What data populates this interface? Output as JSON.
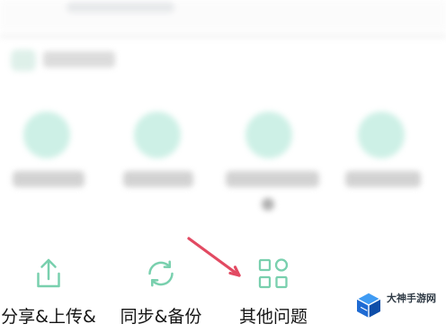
{
  "bottom_actions": [
    {
      "label": "分享&上传&",
      "icon": "share-upload-icon"
    },
    {
      "label": "同步&备份",
      "icon": "sync-icon"
    },
    {
      "label": "其他问题",
      "icon": "grid-add-icon"
    }
  ],
  "watermark": {
    "text": "大神手游网",
    "logo": "box-logo"
  },
  "colors": {
    "accent": "#79d0ae",
    "blur_card": "#c9efe4",
    "arrow": "#e24a62",
    "text": "#151515"
  }
}
